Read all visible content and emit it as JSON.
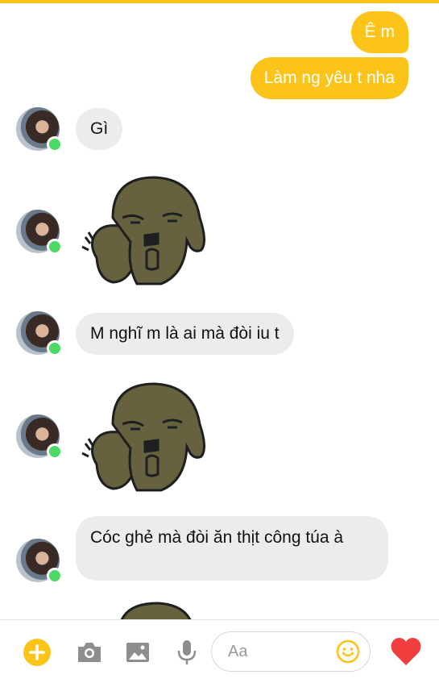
{
  "colors": {
    "accent": "#fcc419",
    "incoming_bubble": "#ececec",
    "online": "#4cd964",
    "heart": "#f03e3e",
    "icon_gray": "#8e8e8e"
  },
  "messages": [
    {
      "direction": "outgoing",
      "text": "Ê m"
    },
    {
      "direction": "outgoing",
      "text": "Làm ng yêu t nha"
    },
    {
      "direction": "incoming",
      "text": "Gì"
    },
    {
      "direction": "incoming",
      "sticker": "dog-thumbs-down-sticker"
    },
    {
      "direction": "incoming",
      "text": "M nghĩ m là ai mà đòi iu t"
    },
    {
      "direction": "incoming",
      "sticker": "dog-thumbs-down-sticker"
    },
    {
      "direction": "incoming",
      "text": "Cóc ghẻ mà đòi ăn thịt công túa à"
    },
    {
      "direction": "incoming",
      "sticker": "dog-thumbs-down-sticker"
    }
  ],
  "composer": {
    "placeholder": "Aa",
    "icons": [
      "plus-icon",
      "camera-icon",
      "image-icon",
      "microphone-icon",
      "emoji-icon",
      "heart-icon"
    ]
  }
}
